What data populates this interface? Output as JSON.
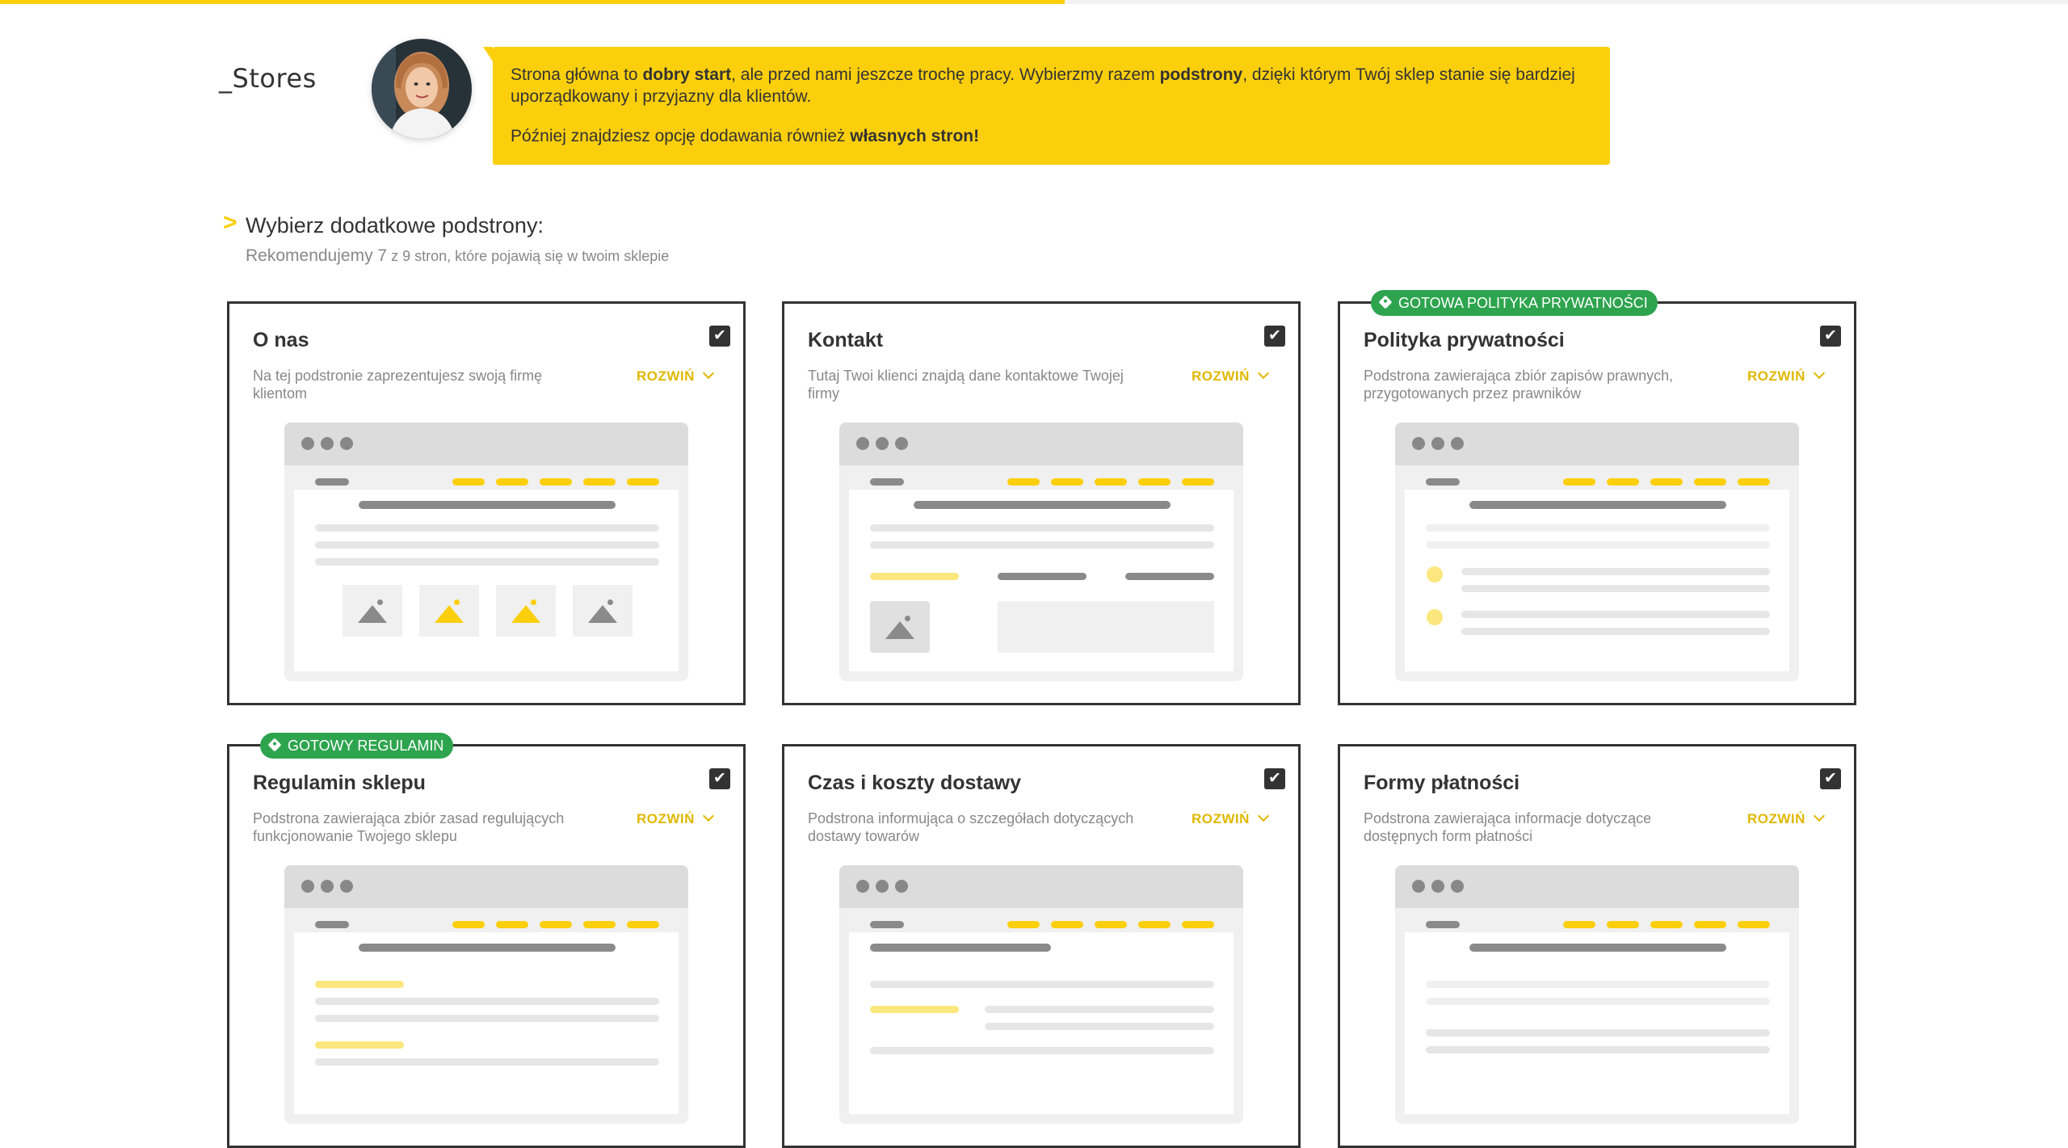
{
  "progress": {
    "fraction": 0.515
  },
  "brand": {
    "logo": "_Stores"
  },
  "assistant": {
    "line1": [
      {
        "text": "Strona główna to ",
        "bold": false
      },
      {
        "text": "dobry start",
        "bold": true
      },
      {
        "text": ", ale przed nami jeszcze trochę pracy. Wybierzmy razem ",
        "bold": false
      },
      {
        "text": "podstrony",
        "bold": true
      },
      {
        "text": ", dzięki którym Twój sklep stanie się bardziej uporządkowany i przyjazny dla klientów.",
        "bold": false
      }
    ],
    "line2": [
      {
        "text": "Później znajdziesz opcję dodawania również ",
        "bold": false
      },
      {
        "text": "własnych stron!",
        "bold": true
      }
    ]
  },
  "section": {
    "arrow": ">",
    "title": "Wybierz dodatkowe podstrony:",
    "subtitle_main": "Rekomendujemy 7",
    "subtitle_small": " z 9 stron, które pojawią się w twoim sklepie"
  },
  "cards": [
    {
      "title": "O nas",
      "desc": "Na tej podstronie zaprezentujesz swoją firmę klientom",
      "expand": "ROZWIŃ",
      "checked": true,
      "badge": ""
    },
    {
      "title": "Kontakt",
      "desc": "Tutaj Twoi klienci znajdą dane kontaktowe Twojej firmy",
      "expand": "ROZWIŃ",
      "checked": true,
      "badge": ""
    },
    {
      "title": "Polityka prywatności",
      "desc": "Podstrona zawierająca zbiór zapisów prawnych, przygotowanych przez prawników",
      "expand": "ROZWIŃ",
      "checked": true,
      "badge": "GOTOWA POLITYKA PRYWATNOŚCI"
    },
    {
      "title": "Regulamin sklepu",
      "desc": "Podstrona zawierająca zbiór zasad regulujących funkcjonowanie Twojego sklepu",
      "expand": "ROZWIŃ",
      "checked": true,
      "badge": "GOTOWY REGULAMIN"
    },
    {
      "title": "Czas i koszty dostawy",
      "desc": "Podstrona informująca o szczegółach dotyczących dostawy towarów",
      "expand": "ROZWIŃ",
      "checked": true,
      "badge": ""
    },
    {
      "title": "Formy płatności",
      "desc": "Podstrona zawierająca informacje dotyczące dostępnych form płatności",
      "expand": "ROZWIŃ",
      "checked": true,
      "badge": ""
    }
  ],
  "icons": {
    "checkbox": "checkmark-icon",
    "expand": "chevron-down-icon",
    "badge": "tag-icon"
  },
  "colors": {
    "accent": "#fccf0d",
    "badge": "#2ea44f",
    "text": "#333333",
    "muted": "#888888"
  }
}
